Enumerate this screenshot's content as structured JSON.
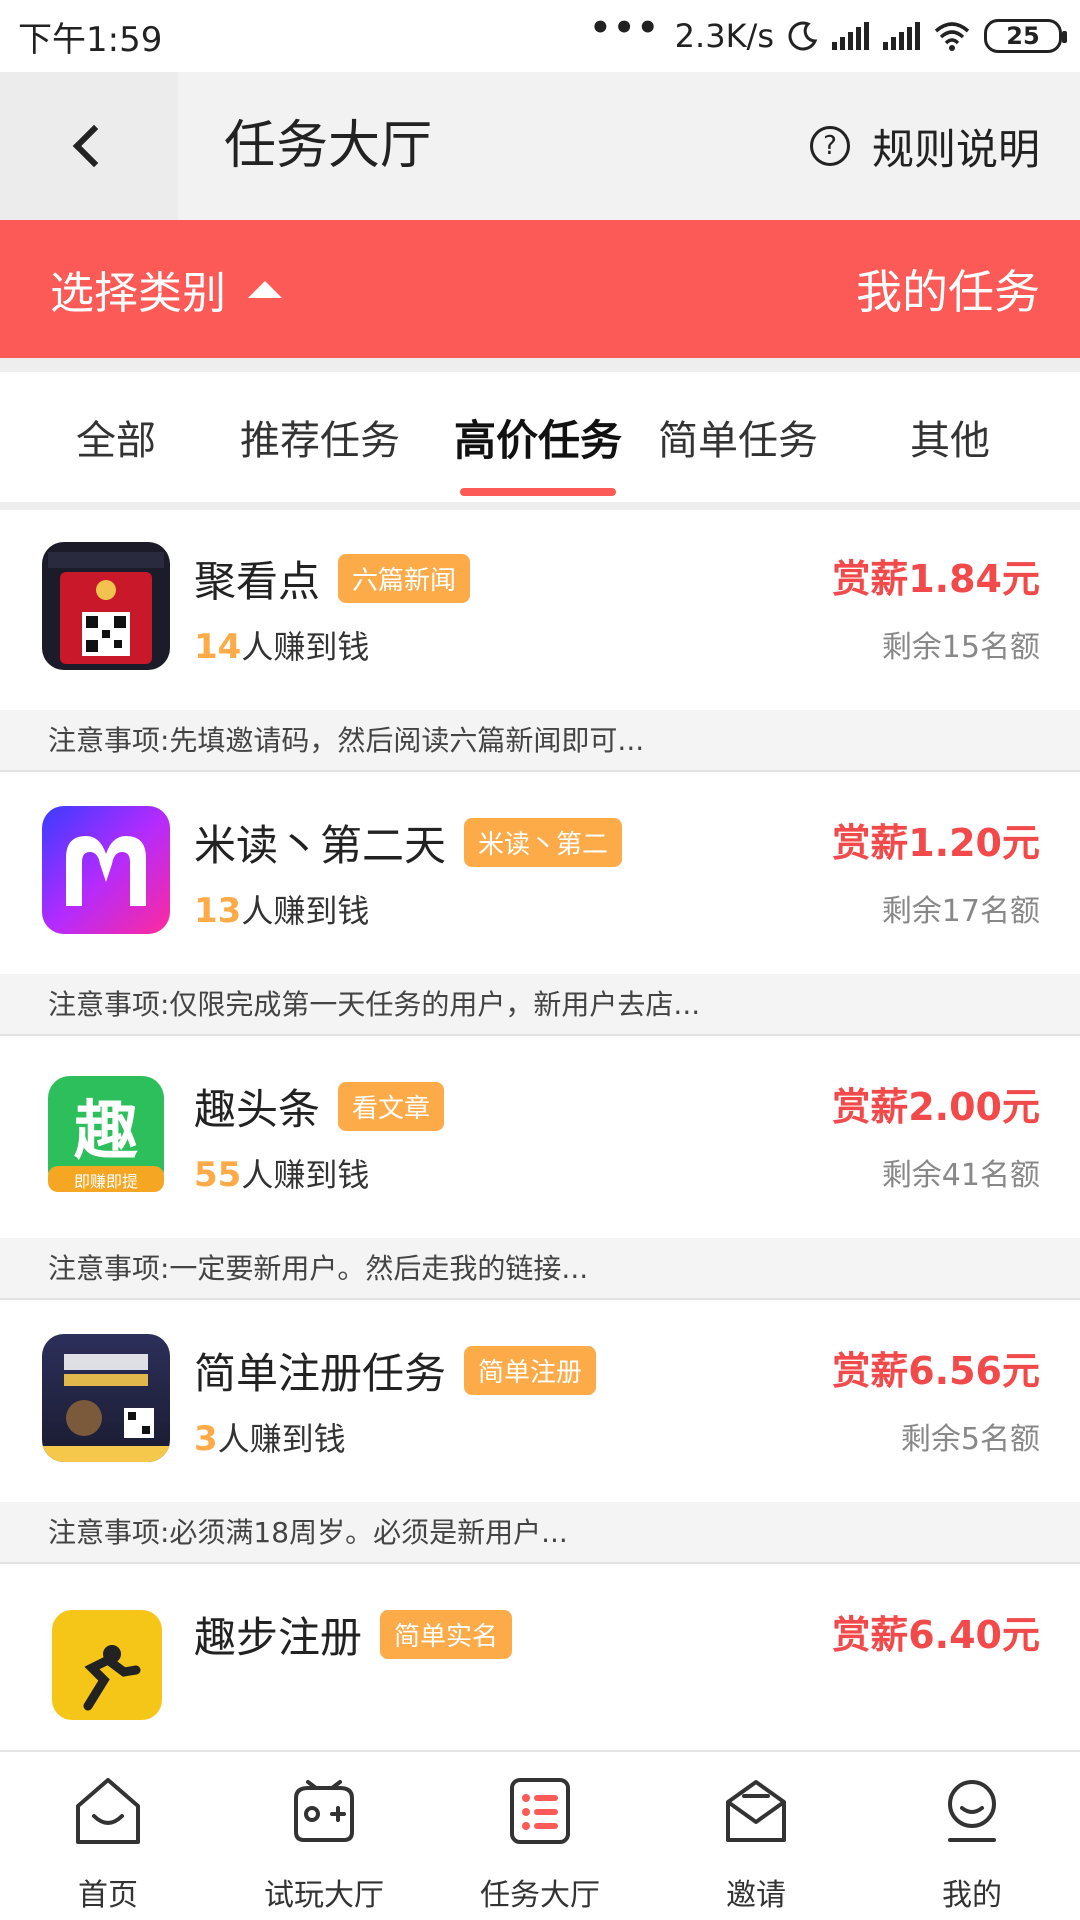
{
  "status_bar": {
    "time": "下午1:59",
    "dots": "•••",
    "speed": "2.3K/s",
    "battery": "25"
  },
  "nav": {
    "title": "任务大厅",
    "rules_label": "规则说明",
    "help_glyph": "?"
  },
  "category_bar": {
    "select_label": "选择类别",
    "my_tasks_label": "我的任务"
  },
  "tabs": [
    {
      "label": "全部"
    },
    {
      "label": "推荐任务"
    },
    {
      "label": "高价任务"
    },
    {
      "label": "简单任务"
    },
    {
      "label": "其他"
    }
  ],
  "active_tab": "高价任务",
  "tasks": [
    {
      "name": "聚看点",
      "tag": "六篇新闻",
      "earned_count": "14",
      "earned_suffix": "人赚到钱",
      "reward": "赏薪1.84元",
      "remaining": "剩余15名额",
      "note": "注意事项:先填邀请码，然后阅读六篇新闻即可...",
      "icon": "jukandian-icon"
    },
    {
      "name": "米读丶第二天",
      "tag": "米读丶第二",
      "earned_count": "13",
      "earned_suffix": "人赚到钱",
      "reward": "赏薪1.20元",
      "remaining": "剩余17名额",
      "note": "注意事项:仅限完成第一天任务的用户，新用户去店...",
      "icon": "midu-icon"
    },
    {
      "name": "趣头条",
      "tag": "看文章",
      "earned_count": "55",
      "earned_suffix": "人赚到钱",
      "reward": "赏薪2.00元",
      "remaining": "剩余41名额",
      "note": "注意事项:一定要新用户。然后走我的链接...",
      "icon": "qutoutiao-icon",
      "icon_text": "趣",
      "icon_sub": "即赚即提"
    },
    {
      "name": "简单注册任务",
      "tag": "简单注册",
      "earned_count": "3",
      "earned_suffix": "人赚到钱",
      "reward": "赏薪6.56元",
      "remaining": "剩余5名额",
      "note": "注意事项:必须满18周岁。必须是新用户...",
      "icon": "register-poster-icon"
    },
    {
      "name": "趣步注册",
      "tag": "简单实名",
      "reward": "赏薪6.40元",
      "icon": "qubu-icon"
    }
  ],
  "bottom_nav": [
    {
      "label": "首页",
      "icon": "home-icon"
    },
    {
      "label": "试玩大厅",
      "icon": "gamepad-icon"
    },
    {
      "label": "任务大厅",
      "icon": "task-list-icon"
    },
    {
      "label": "邀请",
      "icon": "invite-envelope-icon"
    },
    {
      "label": "我的",
      "icon": "profile-icon"
    }
  ],
  "colors": {
    "accent_red": "#fb5a57",
    "tag_orange": "#fdab49",
    "reward_red": "#f24a4a"
  }
}
